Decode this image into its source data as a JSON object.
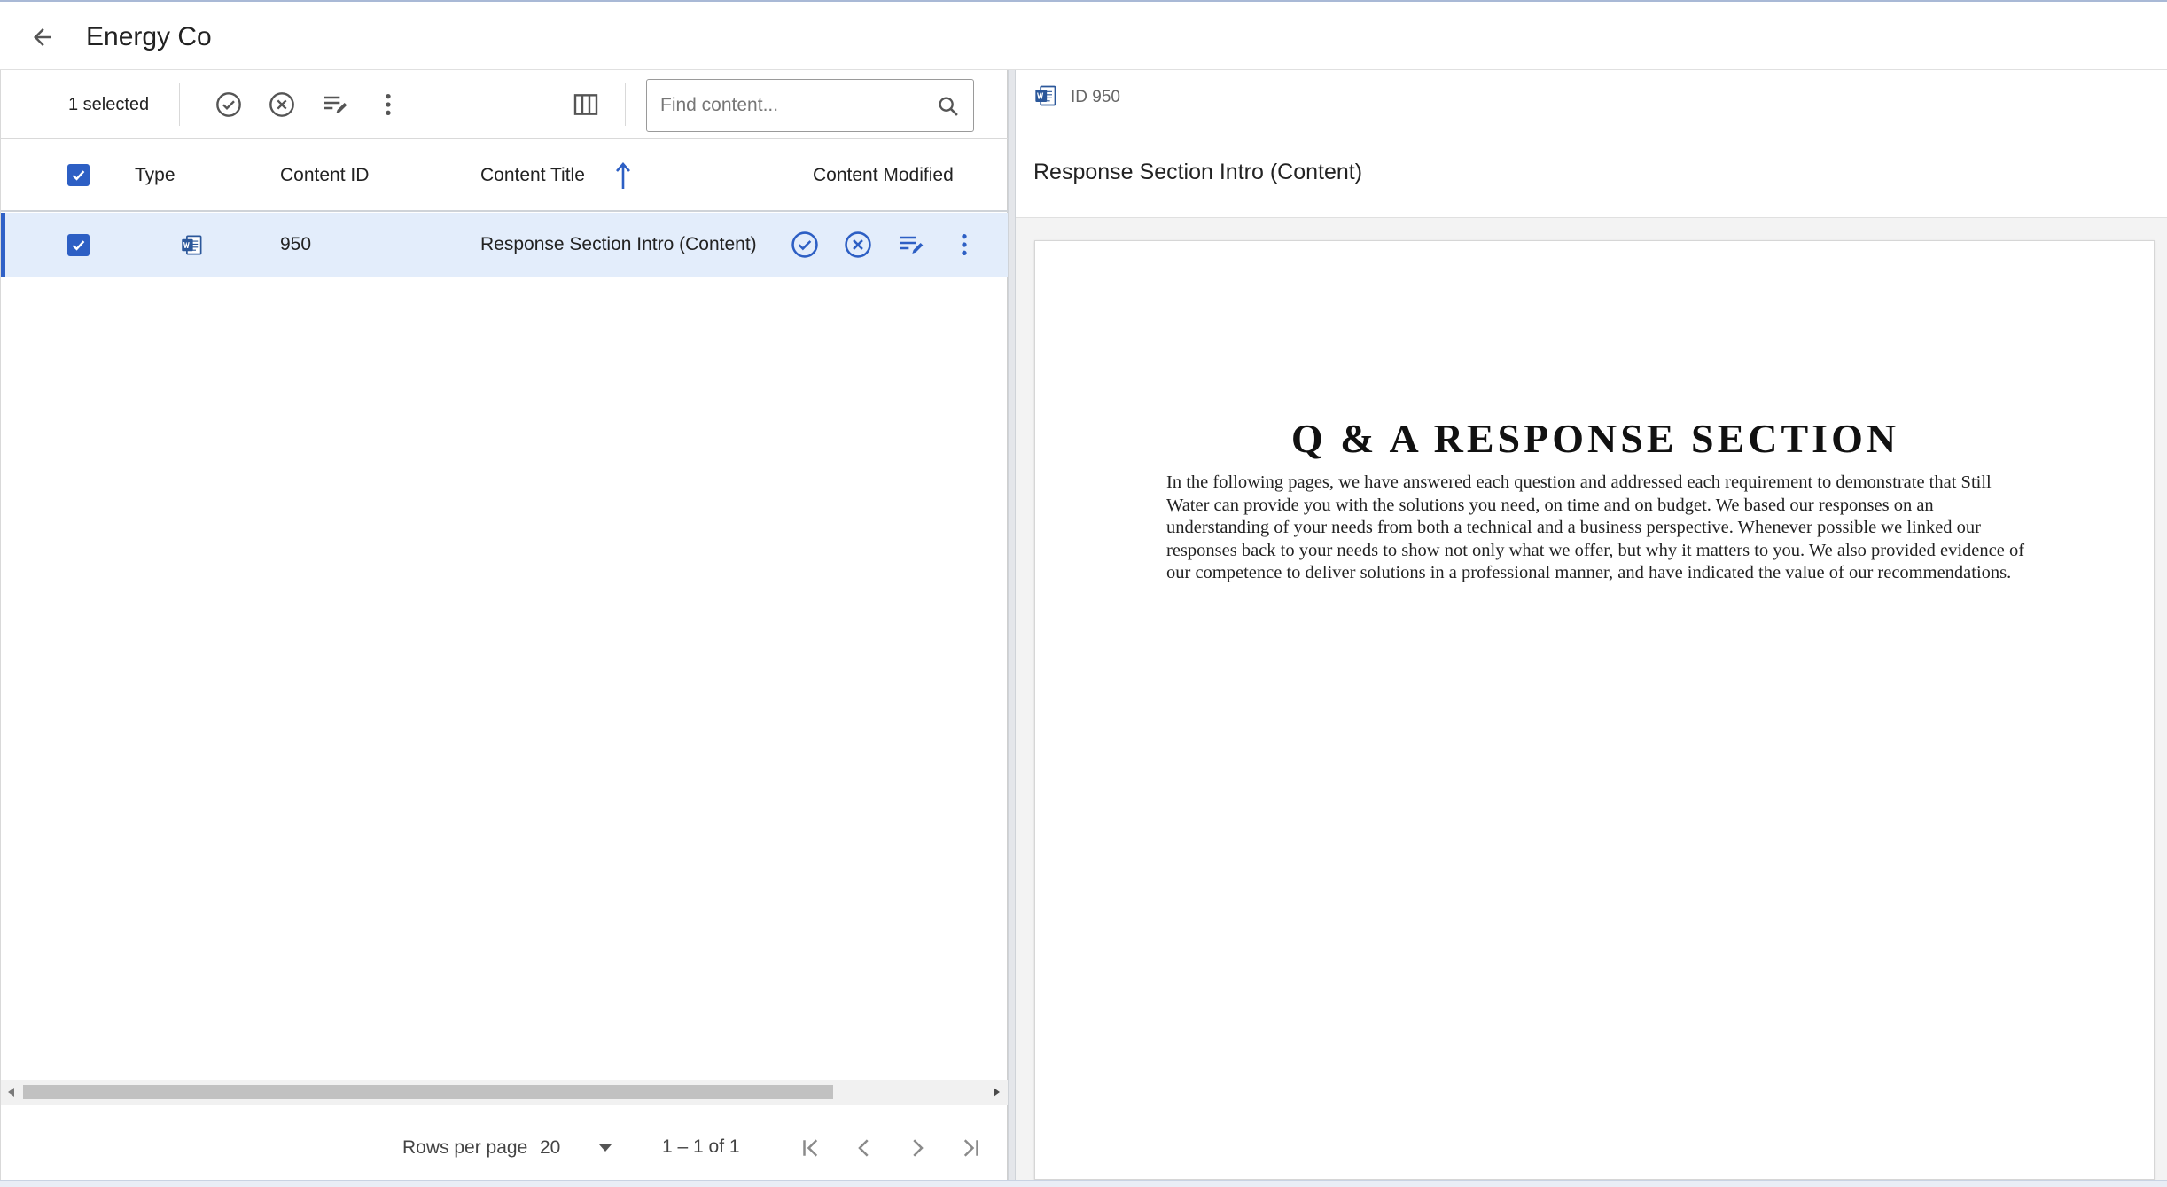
{
  "header": {
    "title": "Energy Co"
  },
  "toolbar": {
    "selected_label": "1 selected",
    "search_placeholder": "Find content..."
  },
  "table": {
    "columns": {
      "type": "Type",
      "content_id": "Content ID",
      "content_title": "Content Title",
      "content_modified": "Content Modified"
    },
    "sort": {
      "column": "content_title",
      "direction": "ascending"
    },
    "rows": [
      {
        "selected": true,
        "type_icon": "word-document-icon",
        "content_id": "950",
        "content_title": "Response Section Intro (Content)"
      }
    ]
  },
  "footer": {
    "rows_per_page_label": "Rows per page",
    "rows_per_page_value": "20",
    "range_text": "1 – 1 of 1"
  },
  "preview": {
    "id_label": "ID 950",
    "title": "Response Section Intro (Content)",
    "document": {
      "heading": "Q & A RESPONSE SECTION",
      "body": "In the following pages, we have answered each question and addressed each requirement to demonstrate that Still Water can provide you with the solutions you need, on time and on budget. We based our responses on an understanding of your needs from both a technical and a business perspective. Whenever possible we linked our responses back to your needs to show not only what we offer, but why it matters to you. We also provided evidence of our competence to deliver solutions in a professional manner, and have indicated the value of our recommendations."
    }
  },
  "colors": {
    "accent": "#2d5fc4",
    "selected_row": "#e3edfb",
    "word_blue": "#2b579a"
  }
}
